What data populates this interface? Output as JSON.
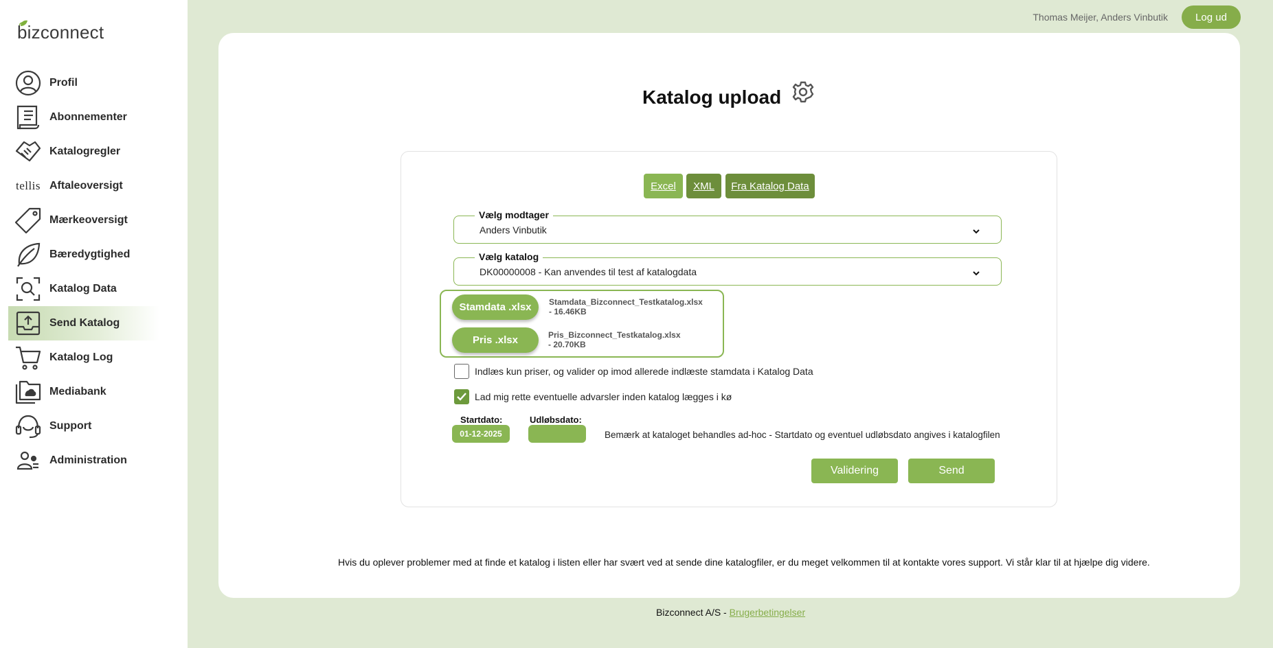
{
  "brand": {
    "name": "bizconnect",
    "accent": "#8ab653",
    "accent_dark": "#6d8e3b"
  },
  "sidebar": {
    "items": [
      {
        "label": "Profil",
        "icon": "user-circle-icon"
      },
      {
        "label": "Abonnementer",
        "icon": "document-icon"
      },
      {
        "label": "Katalogregler",
        "icon": "handshake-icon"
      },
      {
        "label": "Aftaleoversigt",
        "icon": "tellis-logo",
        "icon_text": "tellis"
      },
      {
        "label": "Mærkeoversigt",
        "icon": "tag-icon"
      },
      {
        "label": "Bæredygtighed",
        "icon": "leaf-icon"
      },
      {
        "label": "Katalog Data",
        "icon": "search-frame-icon"
      },
      {
        "label": "Send Katalog",
        "icon": "upload-tray-icon",
        "active": true
      },
      {
        "label": "Katalog Log",
        "icon": "cart-icon"
      },
      {
        "label": "Mediabank",
        "icon": "folder-cloud-icon"
      },
      {
        "label": "Support",
        "icon": "headset-icon"
      },
      {
        "label": "Administration",
        "icon": "users-admin-icon"
      }
    ]
  },
  "header": {
    "user": "Thomas Meijer, Anders Vinbutik",
    "logout_label": "Log ud"
  },
  "main": {
    "title": "Katalog upload",
    "tabs": [
      {
        "label": "Excel",
        "selected": true
      },
      {
        "label": "XML",
        "selected": false
      },
      {
        "label": "Fra Katalog Data",
        "selected": false
      }
    ],
    "receiver": {
      "legend": "Vælg modtager",
      "value": "Anders Vinbutik"
    },
    "catalog": {
      "legend": "Vælg katalog",
      "value": "DK00000008 - Kan anvendes til test af katalogdata"
    },
    "uploads": [
      {
        "button": "Stamdata .xlsx",
        "file": "Stamdata_Bizconnect_Testkatalog.xlsx",
        "size": "- 16.46KB"
      },
      {
        "button": "Pris .xlsx",
        "file": "Pris_Bizconnect_Testkatalog.xlsx",
        "size": "- 20.70KB"
      }
    ],
    "options": [
      {
        "label": "Indlæs kun priser, og valider op imod allerede indlæste stamdata i Katalog Data",
        "checked": false
      },
      {
        "label": "Lad mig rette eventuelle advarsler inden katalog lægges i kø",
        "checked": true
      }
    ],
    "start_label": "Startdato:",
    "start_value": "01-12-2025",
    "expiry_label": "Udløbsdato:",
    "expiry_value": "",
    "note": "Bemærk at kataloget behandles ad-hoc - Startdato og eventuel udløbsdato angives i katalogfilen",
    "validate_label": "Validering",
    "send_label": "Send",
    "help": "Hvis du oplever problemer med at finde et katalog i listen eller har svært ved at sende dine katalogfiler, er du meget velkommen til at kontakte vores support. Vi står klar til at hjælpe dig videre."
  },
  "footer": {
    "company": "Bizconnect A/S - ",
    "terms_link": "Brugerbetingelser"
  }
}
